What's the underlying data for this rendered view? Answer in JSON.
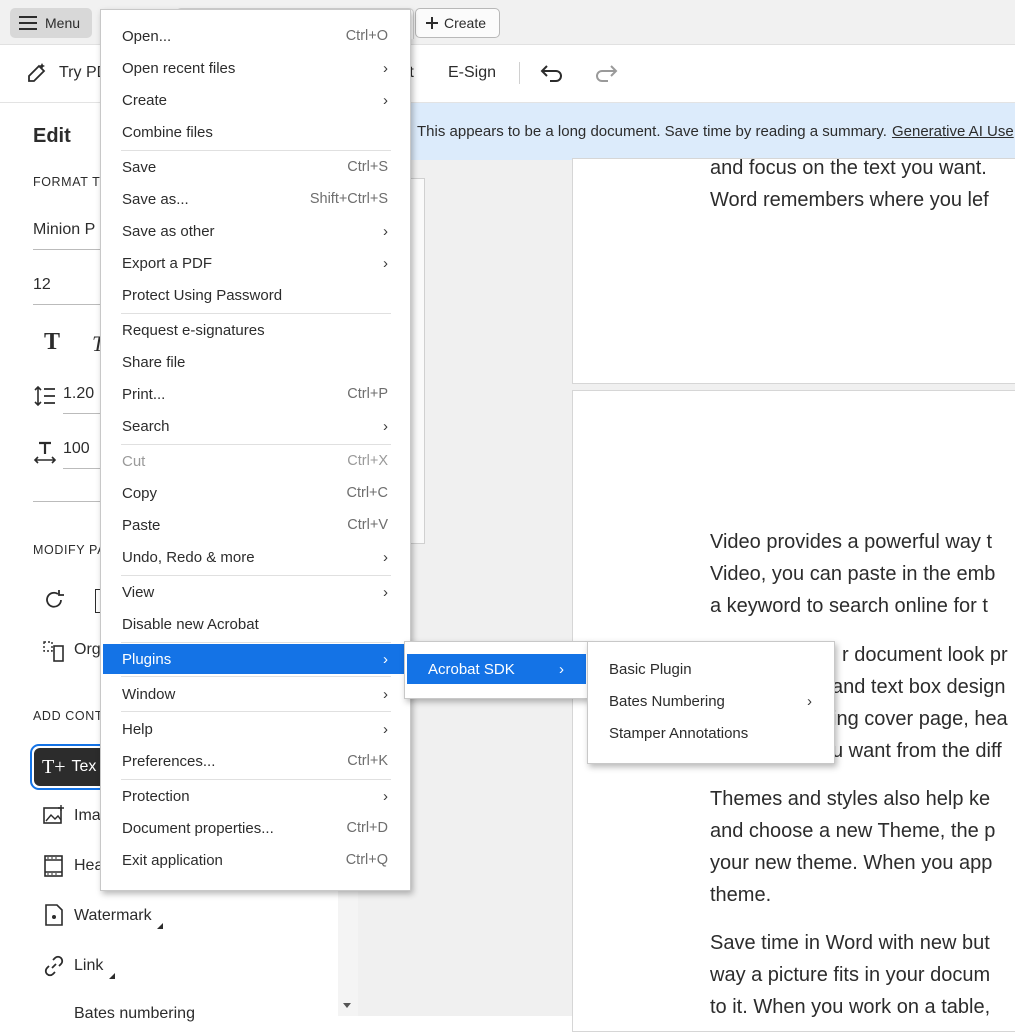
{
  "topbar": {
    "menu_label": "Menu",
    "create_label": "Create"
  },
  "toolbar": {
    "try_label": "Try PD",
    "partial_label": "rt",
    "esign_label": "E-Sign"
  },
  "left_panel": {
    "edit_title": "Edit",
    "format_text_header": "FORMAT T",
    "font_value": "Minion P",
    "size_value": "12",
    "line_spacing_value": "1.20",
    "char_spacing_value": "100",
    "modify_header": "MODIFY PA",
    "organize_label": "Org",
    "add_content_header": "ADD CONT",
    "text_button_label": "Tex",
    "image_label": "Ima",
    "header_label": "Hea",
    "watermark_label": "Watermark",
    "link_label": "Link",
    "bates_label": "Bates numbering"
  },
  "banner": {
    "text": "This appears to be a long document. Save time by reading a summary.",
    "link": "Generative AI Use"
  },
  "document": {
    "page1_lines": [
      "and focus on the text you want.",
      "Word remembers where you lef"
    ],
    "page2_lines": [
      "Video provides a powerful way t",
      "Video, you can paste in the emb",
      "a keyword to search online for t",
      "r document look pr",
      "and text box design",
      "ing cover page, hea",
      "u want from the diff",
      "Themes and styles also help ke",
      "and choose a new Theme, the p",
      "your new theme. When you app",
      "theme.",
      "Save time in Word with new but",
      "way a picture fits in your docum",
      "to it. When you work on a table,"
    ]
  },
  "main_menu": {
    "items": [
      {
        "label": "Open...",
        "shortcut": "Ctrl+O"
      },
      {
        "label": "Open recent files",
        "submenu": true
      },
      {
        "label": "Create",
        "submenu": true
      },
      {
        "label": "Combine files"
      },
      {
        "label": "Save",
        "shortcut": "Ctrl+S"
      },
      {
        "label": "Save as...",
        "shortcut": "Shift+Ctrl+S"
      },
      {
        "label": "Save as other",
        "submenu": true
      },
      {
        "label": "Export a PDF",
        "submenu": true
      },
      {
        "label": "Protect Using Password"
      },
      {
        "label": "Request e-signatures"
      },
      {
        "label": "Share file"
      },
      {
        "label": "Print...",
        "shortcut": "Ctrl+P"
      },
      {
        "label": "Search",
        "submenu": true
      },
      {
        "label": "Cut",
        "shortcut": "Ctrl+X",
        "disabled": true
      },
      {
        "label": "Copy",
        "shortcut": "Ctrl+C"
      },
      {
        "label": "Paste",
        "shortcut": "Ctrl+V"
      },
      {
        "label": "Undo, Redo & more",
        "submenu": true
      },
      {
        "label": "View",
        "submenu": true
      },
      {
        "label": "Disable new Acrobat"
      },
      {
        "label": "Plugins",
        "submenu": true,
        "highlighted": true
      },
      {
        "label": "Window",
        "submenu": true
      },
      {
        "label": "Help",
        "submenu": true
      },
      {
        "label": "Preferences...",
        "shortcut": "Ctrl+K"
      },
      {
        "label": "Protection",
        "submenu": true
      },
      {
        "label": "Document properties...",
        "shortcut": "Ctrl+D"
      },
      {
        "label": "Exit application",
        "shortcut": "Ctrl+Q"
      }
    ]
  },
  "plugins_submenu": {
    "items": [
      {
        "label": "Acrobat SDK",
        "submenu": true,
        "highlighted": true
      }
    ]
  },
  "sdk_submenu": {
    "items": [
      {
        "label": "Basic Plugin"
      },
      {
        "label": "Bates Numbering",
        "submenu": true
      },
      {
        "label": "Stamper Annotations"
      }
    ]
  },
  "colors": {
    "highlight": "#1473e6",
    "banner": "#dcebfb",
    "text": "#2c2c2c"
  }
}
